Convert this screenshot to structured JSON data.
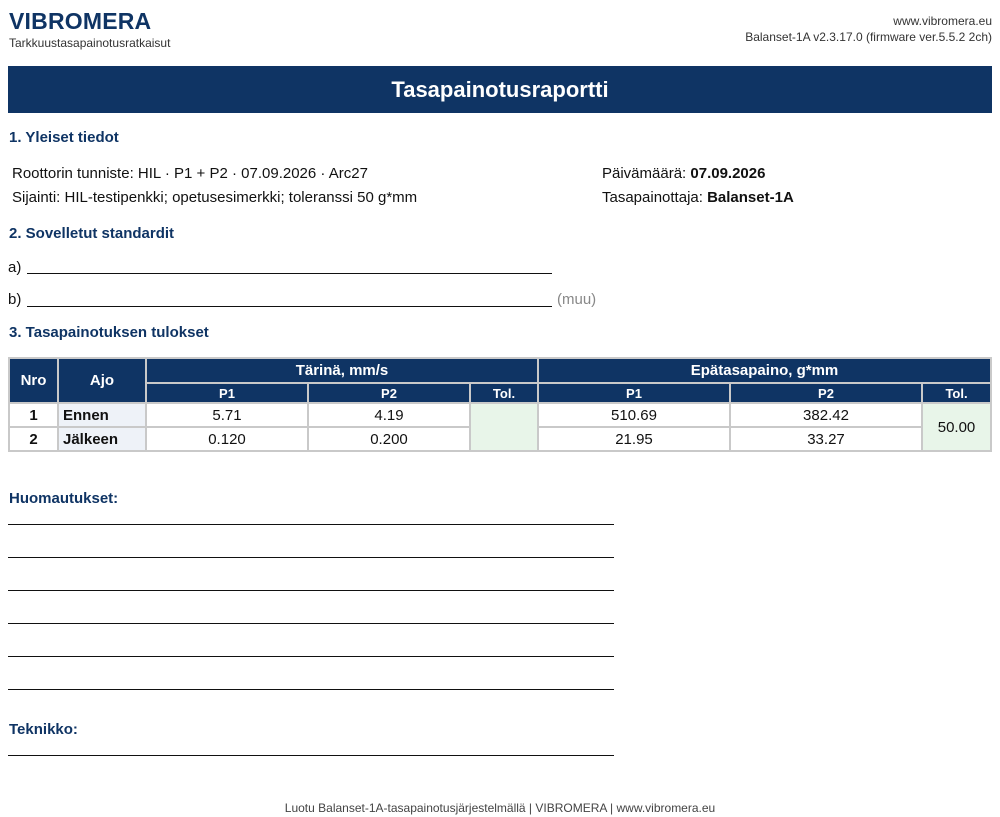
{
  "header": {
    "brand": "VIBROMERA",
    "tagline": "Tarkkuustasapainotusratkaisut",
    "website": "www.vibromera.eu",
    "version": "Balanset-1A v2.3.17.0 (firmware ver.5.5.2 2ch)"
  },
  "report_title": "Tasapainotusraportti",
  "section1": {
    "title": "1. Yleiset tiedot",
    "rotor_label": "Roottorin tunniste:",
    "rotor_value": "HIL · P1 + P2 · 07.09.2026 · Arc27",
    "location_label": "Sijainti:",
    "location_value": "HIL-testipenkki; opetusesimerkki; toleranssi 50 g*mm",
    "date_label": "Päivämäärä:",
    "date_value": "07.09.2026",
    "balancer_label": "Tasapainottaja:",
    "balancer_value": "Balanset-1A"
  },
  "section2": {
    "title": "2. Sovelletut standardit",
    "a_label": "a)",
    "b_label": "b)",
    "other_note": "(muu)"
  },
  "section3": {
    "title": "3. Tasapainotuksen tulokset",
    "col_nro": "Nro",
    "col_ajo": "Ajo",
    "group_vibration": "Tärinä, mm/s",
    "group_unbalance": "Epätasapaino, g*mm",
    "sub_p1": "P1",
    "sub_p2": "P2",
    "sub_tol": "Tol.",
    "rows": [
      {
        "nro": "1",
        "ajo": "Ennen",
        "vib_p1": "5.71",
        "vib_p2": "4.19",
        "unb_p1": "510.69",
        "unb_p2": "382.42"
      },
      {
        "nro": "2",
        "ajo": "Jälkeen",
        "vib_p1": "0.120",
        "vib_p2": "0.200",
        "unb_p1": "21.95",
        "unb_p2": "33.27"
      }
    ],
    "vib_tol": "",
    "unb_tol": "50.00"
  },
  "remarks_title": "Huomautukset:",
  "technician_title": "Teknikko:",
  "footer": "Luotu Balanset-1A-tasapainotusjärjestelmällä | VIBROMERA | www.vibromera.eu",
  "colors": {
    "primary": "#0f3464",
    "tolerance_bg": "#e8f5e9",
    "run_bg": "#eef2f8"
  }
}
